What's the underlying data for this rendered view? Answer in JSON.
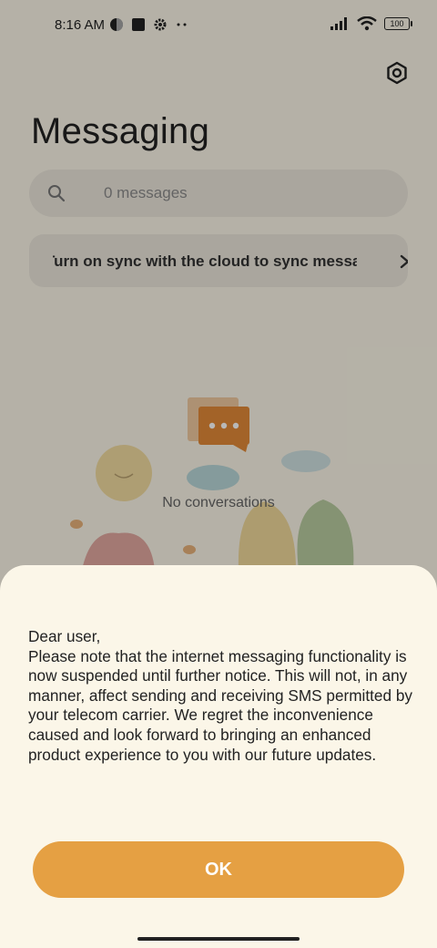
{
  "status_bar": {
    "time": "8:16 AM",
    "battery": "100",
    "icons": [
      "vpn-icon",
      "square-icon",
      "gear-icon",
      "more-dots-icon",
      "signal-icon",
      "wifi-icon",
      "battery-icon"
    ]
  },
  "header": {
    "title": "Messaging",
    "settings_icon": "settings-icon"
  },
  "search": {
    "placeholder": "0 messages",
    "icon": "search-icon"
  },
  "sync_banner": {
    "text": "Turn on sync with the cloud to sync messages",
    "icon": "chevron-right-icon"
  },
  "empty_state": {
    "text": "No conversations"
  },
  "dialog": {
    "greeting": "Dear user,",
    "body": "Please note that the internet messaging functionality is now suspended until further notice. This will not, in any manner, affect sending and receiving SMS permitted by your telecom carrier. We regret the inconvenience caused and look forward to bringing an enhanced product experience to you with our future updates.",
    "ok_label": "OK"
  },
  "colors": {
    "accent": "#e5a043",
    "background": "#fbf6e8",
    "scrim": "rgba(0,0,0,0.28)"
  }
}
